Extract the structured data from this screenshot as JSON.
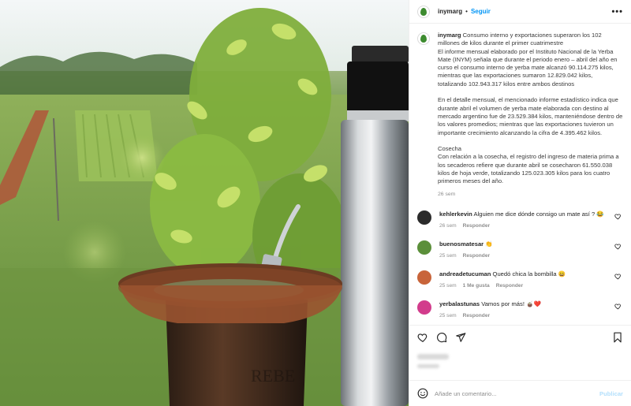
{
  "post": {
    "username": "inymarg",
    "follow_label": "Seguir",
    "separator": "•",
    "more_label": "•••"
  },
  "caption": {
    "username": "inymarg",
    "headline": "Consumo interno y exportaciones superaron los 102 millones de kilos durante el primer cuatrimestre",
    "paragraph1": "El informe mensual elaborado por el Instituto Nacional de la Yerba Mate (INYM) señala que durante el periodo enero – abril del año en curso el consumo interno de yerba mate alcanzó 90.114.275 kilos, mientras que las exportaciones sumaron 12.829.042 kilos, totalizando 102.943.317 kilos entre ambos destinos",
    "paragraph2": "En el detalle mensual, el mencionado informe estadístico indica que durante abril el volumen de yerba mate elaborada con destino al mercado argentino fue de 23.529.384 kilos, manteniéndose dentro de los valores promedios; mientras que las exportaciones tuvieron un importante crecimiento alcanzando la cifra de 4.395.462 kilos.",
    "paragraph3_title": "Cosecha",
    "paragraph3": "Con relación a la cosecha, el registro del ingreso de materia prima a los secaderos refiere que durante abril se cosecharon 61.550.038 kilos de hoja verde, totalizando 125.023.305 kilos para los cuatro primeros meses del año.",
    "time": "26 sem"
  },
  "comments": [
    {
      "username": "kehlerkevin",
      "text": "Alguien me dice dónde consigo un mate así ? 😂",
      "time": "26 sem",
      "likes": "",
      "reply": "Responder",
      "avatar_color": "#2b2b2b"
    },
    {
      "username": "buenosmatesar",
      "text": "👏",
      "time": "25 sem",
      "likes": "",
      "reply": "Responder",
      "avatar_color": "#5b8f3a"
    },
    {
      "username": "andreadetucuman",
      "text": "Quedó chica la bombilla 😄",
      "time": "25 sem",
      "likes": "1 Me gusta",
      "reply": "Responder",
      "avatar_color": "#c8643a"
    },
    {
      "username": "yerbalastunas",
      "text": "Vamos por más! 🧉❤️",
      "time": "25 sem",
      "likes": "",
      "reply": "Responder",
      "avatar_color": "#d23c8c"
    }
  ],
  "add_comment": {
    "placeholder": "Añade un comentario...",
    "publish_label": "Publicar"
  },
  "photo": {
    "gourd_text": "REBE"
  },
  "icons": [
    "heart-icon",
    "comment-icon",
    "share-icon",
    "bookmark-icon",
    "emoji-icon",
    "more-icon"
  ],
  "colors": {
    "link": "#0095f6",
    "secondary_text": "#8e8e8e",
    "border": "#efefef"
  }
}
